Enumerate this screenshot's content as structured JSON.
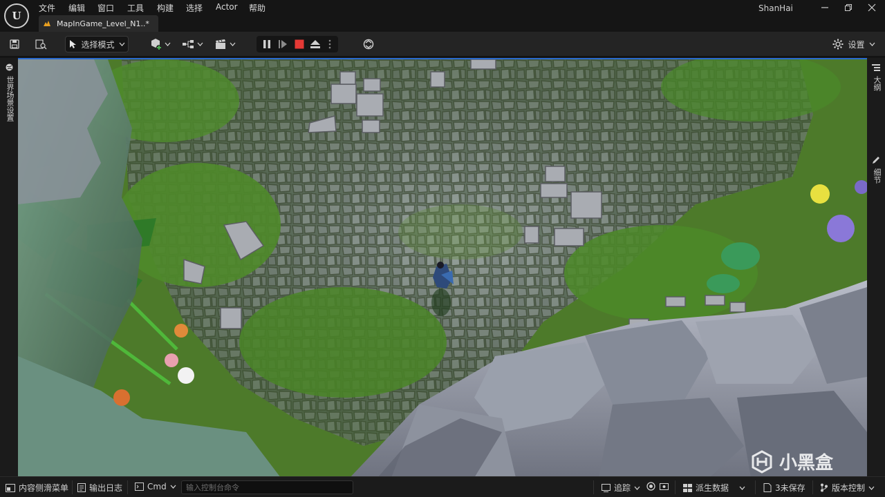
{
  "app": {
    "logo_letter": "U",
    "user": "ShanHai"
  },
  "menu": {
    "items": [
      "文件",
      "编辑",
      "窗口",
      "工具",
      "构建",
      "选择",
      "Actor",
      "帮助"
    ]
  },
  "tab": {
    "title": "MapInGame_Level_N1..*"
  },
  "toolbar": {
    "mode_label": "选择模式",
    "settings_label": "设置"
  },
  "side": {
    "left_tab": "世界场景设置",
    "right_tab_outline": "大纲",
    "right_tab_details": "细节"
  },
  "statusbar": {
    "content_drawer": "内容侧滑菜单",
    "output_log": "输出日志",
    "cmd_label": "Cmd",
    "console_placeholder": "输入控制台命令",
    "trace_label": "追踪",
    "derived_data": "派生数据",
    "unsaved": "3未保存",
    "source_control": "版本控制"
  },
  "watermark": {
    "text": "小黑盒"
  },
  "colors": {
    "accent": "#2a6bd1",
    "stop_button": "#e53935",
    "background": "#151515"
  }
}
